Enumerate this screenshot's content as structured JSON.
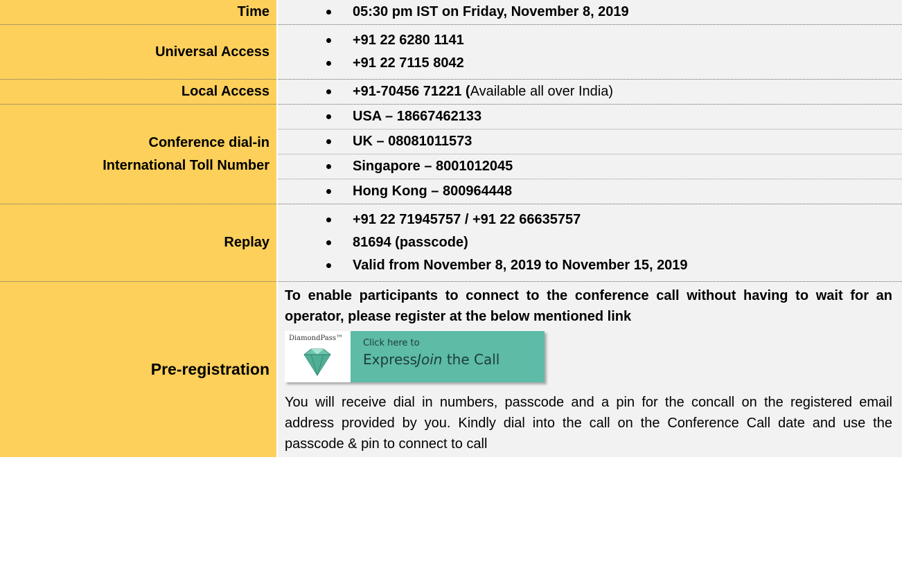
{
  "rows": {
    "time": {
      "label": "Time",
      "items": [
        "05:30 pm IST on Friday, November 8, 2019"
      ]
    },
    "universal": {
      "label": "Universal Access",
      "items": [
        "+91 22 6280 1141",
        "+91 22 7115 8042"
      ]
    },
    "local": {
      "label": "Local Access",
      "number": "+91-70456 71221 (",
      "note": "Available all over India)"
    },
    "international": {
      "label_line1": "Conference dial-in",
      "label_line2": "International Toll Number",
      "items": [
        "USA – 18667462133",
        "UK – 08081011573",
        "Singapore – 8001012045",
        "Hong Kong – 800964448"
      ]
    },
    "replay": {
      "label": "Replay",
      "items": [
        "+91 22 71945757 / +91 22 66635757",
        "81694 (passcode)",
        "Valid from November 8, 2019 to November 15, 2019"
      ]
    },
    "prereg": {
      "label": "Pre-registration",
      "intro": "To enable participants to connect to the conference call without having to wait for an operator, please register at the below mentioned link",
      "banner": {
        "brand": "DiamondPass™",
        "small": "Click here to",
        "big_prefix": "Express",
        "big_italic": "Join",
        "big_suffix": " the Call"
      },
      "note": "You will receive dial in numbers, passcode and a pin for the concall on the registered email address provided by you. Kindly dial into the call on the Conference Call date and use the passcode & pin to connect to call"
    }
  },
  "colors": {
    "label_bg": "#fcd05a",
    "value_bg": "#f2f2f2",
    "banner_bg": "#5dbba6"
  },
  "icons": {
    "diamond": "diamond-icon"
  }
}
